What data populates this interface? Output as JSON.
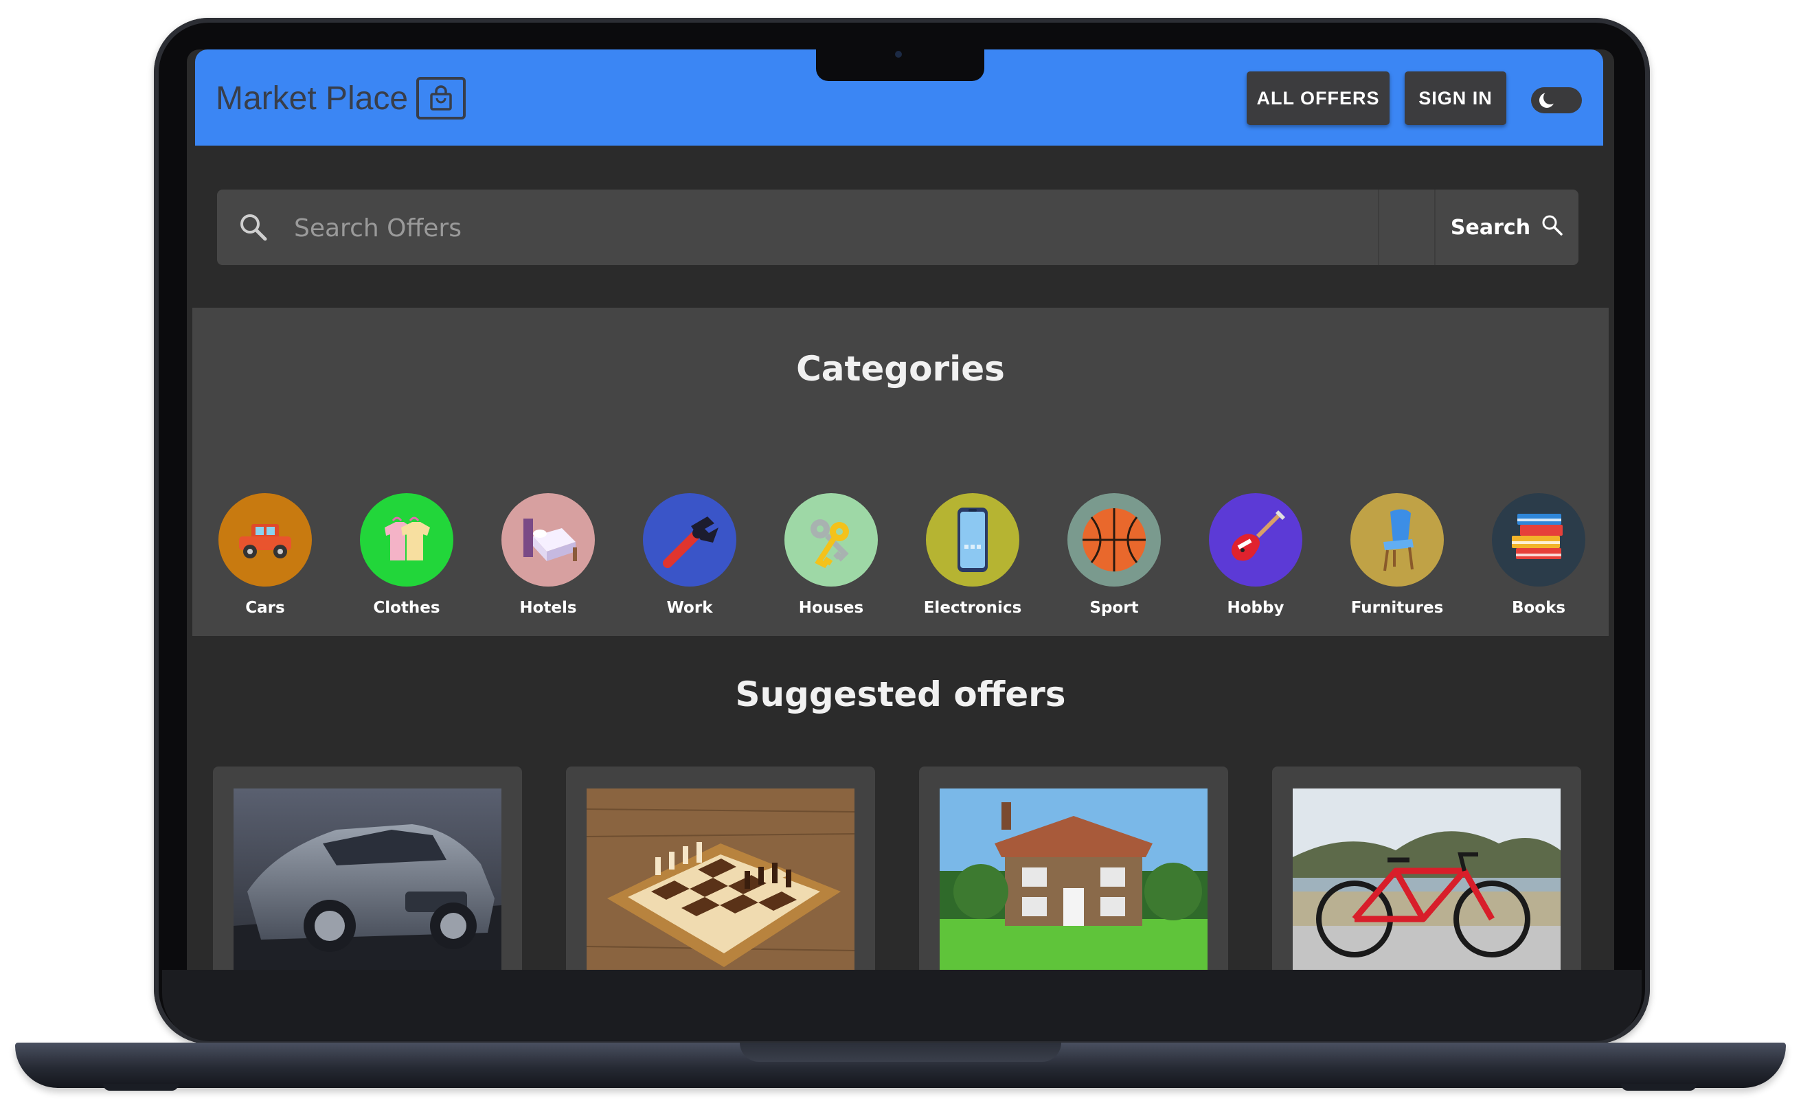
{
  "header": {
    "logo_text": "Market Place",
    "logo_icon": "shopping-bag-icon",
    "nav": {
      "all_offers": "ALL OFFERS",
      "sign_in": "SIGN IN"
    },
    "theme_toggle": {
      "icon": "moon-icon",
      "state": "dark"
    },
    "accent_color": "#3b86f4"
  },
  "search": {
    "placeholder": "Search Offers",
    "value": "",
    "button_label": "Search"
  },
  "categories": {
    "title": "Categories",
    "items": [
      {
        "label": "Cars",
        "icon": "car-icon",
        "color": "#c87a10"
      },
      {
        "label": "Clothes",
        "icon": "clothes-icon",
        "color": "#22d63a"
      },
      {
        "label": "Hotels",
        "icon": "bed-icon",
        "color": "#d7a0a0"
      },
      {
        "label": "Work",
        "icon": "wrench-icon",
        "color": "#3a55c8"
      },
      {
        "label": "Houses",
        "icon": "keys-icon",
        "color": "#9ed8a6"
      },
      {
        "label": "Electronics",
        "icon": "smartphone-icon",
        "color": "#b6b432"
      },
      {
        "label": "Sport",
        "icon": "basketball-icon",
        "color": "#7a9a8e"
      },
      {
        "label": "Hobby",
        "icon": "guitar-icon",
        "color": "#5c3ad6"
      },
      {
        "label": "Furnitures",
        "icon": "chair-icon",
        "color": "#c0a246"
      },
      {
        "label": "Books",
        "icon": "books-icon",
        "color": "#2b3c4a"
      }
    ]
  },
  "suggested": {
    "title": "Suggested offers",
    "offers": [
      {
        "image": "car-photo"
      },
      {
        "image": "chessboard-photo"
      },
      {
        "image": "cottage-house-photo"
      },
      {
        "image": "red-bicycle-photo"
      }
    ]
  }
}
